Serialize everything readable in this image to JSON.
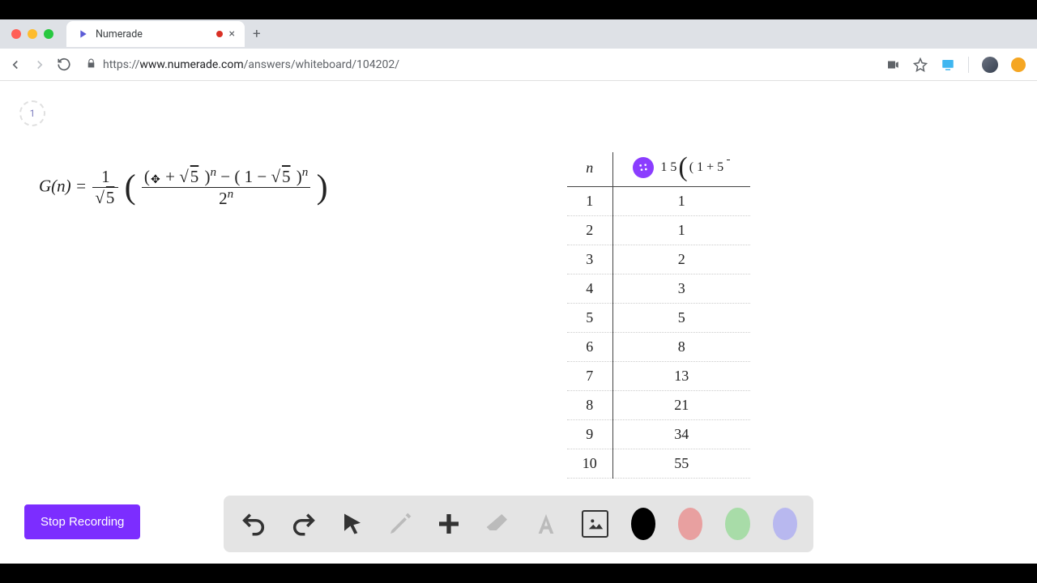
{
  "browser": {
    "tab_title": "Numerade",
    "url_scheme": "https://",
    "url_domain": "www.numerade.com",
    "url_path": "/answers/whiteboard/104202/"
  },
  "page": {
    "marker": "1",
    "formula": {
      "lhs": "G(n) = ",
      "coef_num": "1",
      "coef_den_rad": "5",
      "num_a_rad": "5",
      "num_b_rad": "5",
      "den_base": "2",
      "exp": "n"
    },
    "table": {
      "header_n": "n",
      "header_expr_rad": "5",
      "rows": [
        {
          "n": "1",
          "v": "1"
        },
        {
          "n": "2",
          "v": "1"
        },
        {
          "n": "3",
          "v": "2"
        },
        {
          "n": "4",
          "v": "3"
        },
        {
          "n": "5",
          "v": "5"
        },
        {
          "n": "6",
          "v": "8"
        },
        {
          "n": "7",
          "v": "13"
        },
        {
          "n": "8",
          "v": "21"
        },
        {
          "n": "9",
          "v": "34"
        },
        {
          "n": "10",
          "v": "55"
        }
      ]
    },
    "stop_button": "Stop Recording",
    "toolbar": {
      "swatches": [
        "#000000",
        "#e8a0a0",
        "#a8dca8",
        "#b8b8ef"
      ]
    }
  }
}
